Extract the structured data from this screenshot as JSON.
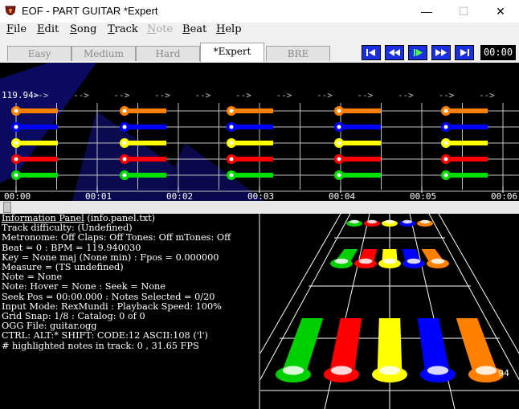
{
  "window": {
    "title": "EOF - PART GUITAR  *Expert",
    "minimize_glyph": "—",
    "maximize_glyph": "☐",
    "close_glyph": "✕"
  },
  "menu": [
    {
      "label": "File",
      "enabled": true
    },
    {
      "label": "Edit",
      "enabled": true
    },
    {
      "label": "Song",
      "enabled": true
    },
    {
      "label": "Track",
      "enabled": true
    },
    {
      "label": "Note",
      "enabled": false
    },
    {
      "label": "Beat",
      "enabled": true
    },
    {
      "label": "Help",
      "enabled": true
    }
  ],
  "difficulty_tabs": [
    {
      "label": "Easy",
      "active": false
    },
    {
      "label": "Medium",
      "active": false
    },
    {
      "label": "Hard",
      "active": false
    },
    {
      "label": "*Expert",
      "active": true
    },
    {
      "label": "BRE",
      "active": false
    }
  ],
  "transport": {
    "buttons": [
      "seek-start-icon",
      "rewind-icon",
      "play-icon",
      "fast-forward-icon",
      "seek-end-icon"
    ],
    "time": "00:00"
  },
  "editor": {
    "bpm_marker": "119.94>",
    "beat_marker": "-->",
    "time_labels": [
      "00:00",
      "00:01",
      "00:02",
      "00:03",
      "00:04",
      "00:05",
      "00:06"
    ],
    "lane_colors": [
      "#ff8000",
      "#0000ff",
      "#ffff00",
      "#ff0000",
      "#00e000"
    ]
  },
  "info_panel": {
    "header": "Information Panel",
    "header_suffix": " (info.panel.txt)",
    "lines": [
      "Track difficulty: (Undefined)",
      "Metronome: Off Claps: Off Tones: Off mTones: Off",
      "Beat = 0 : BPM = 119.940030",
      "Key = None maj (None min) : Fpos = 0.000000",
      "Measure = (TS undefined)",
      "Note = None",
      "Note: Hover = None : Seek = None",
      "Seek Pos = 00:00.000 : Notes Selected = 0/20",
      "Input Mode: RexMundi : Playback Speed: 100%",
      "Grid Snap: 1/8 : Catalog: 0 of 0",
      "OGG File: guitar.ogg",
      "CTRL:   ALT:* SHIFT:   CODE:12 ASCII:108 ('l')",
      "# highlighted notes in track: 0 , 31.65 FPS"
    ]
  },
  "view3d": {
    "corner_number": "94",
    "gem_colors": [
      "#00d000",
      "#ff0000",
      "#ffff00",
      "#0000ff",
      "#ff8000"
    ]
  }
}
